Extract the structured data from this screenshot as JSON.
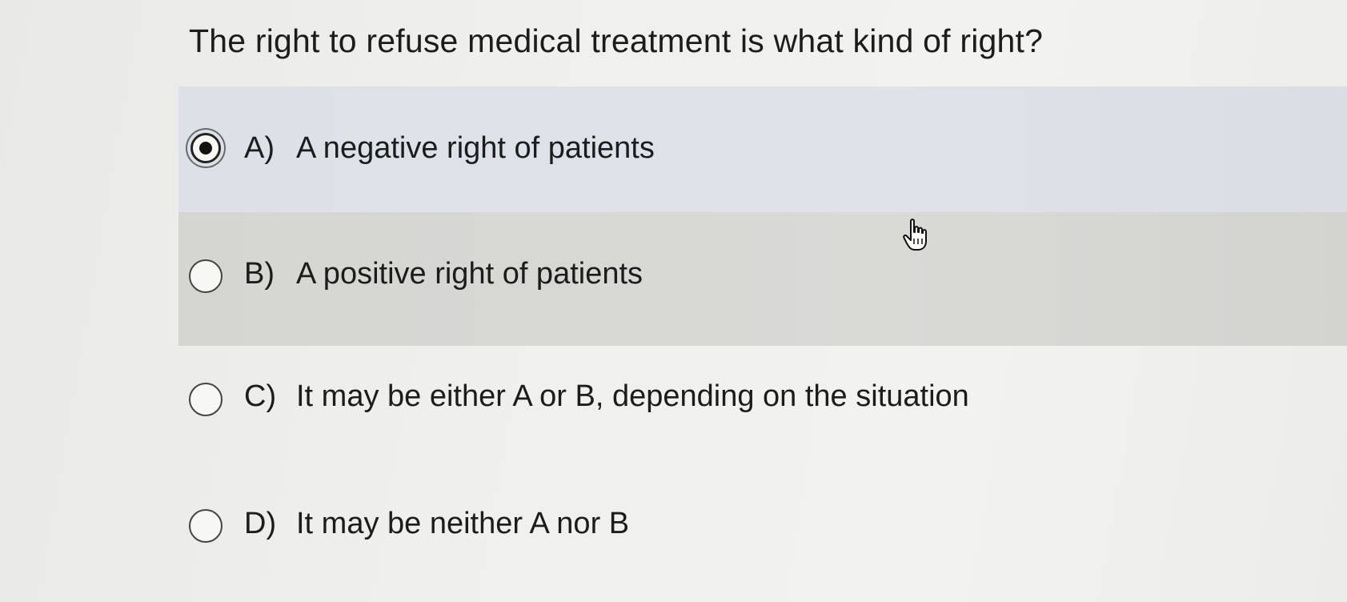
{
  "question": {
    "text": "The right to refuse medical treatment is what kind of right?"
  },
  "options": [
    {
      "letter": "A)",
      "text": "A negative right of patients",
      "selected": true
    },
    {
      "letter": "B)",
      "text": "A positive right of patients",
      "selected": false
    },
    {
      "letter": "C)",
      "text": "It may be either A or B, depending on the situation",
      "selected": false
    },
    {
      "letter": "D)",
      "text": "It may be neither A nor B",
      "selected": false
    }
  ],
  "cursor": {
    "icon": "hand-pointer-icon"
  },
  "colors": {
    "selected_row": "#dbe1e6",
    "hover_row": "#d7d7d4",
    "background": "#efefed"
  }
}
